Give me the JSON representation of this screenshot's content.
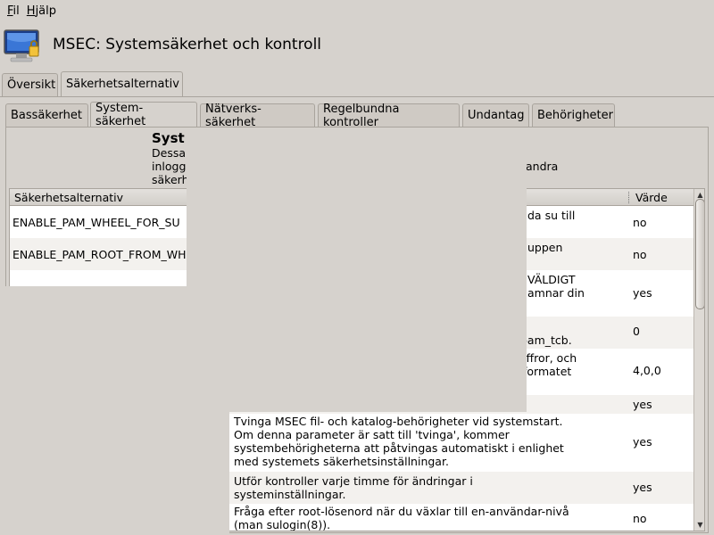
{
  "menubar": {
    "items": [
      {
        "label_first": "F",
        "label_rest": "il"
      },
      {
        "label_first": "H",
        "label_rest": "jälp"
      }
    ]
  },
  "app": {
    "title": "MSEC: Systemsäkerhet och kontroll",
    "icon": "monitor-lock-icon"
  },
  "top_tabs": [
    {
      "label": "Översikt",
      "active": false
    },
    {
      "label": "Säkerhetsalternativ",
      "active": true
    }
  ],
  "sub_tabs": [
    {
      "label": "Bassäkerhet",
      "active": false
    },
    {
      "label": "System-säkerhet",
      "active": true
    },
    {
      "label": "Nätverks-säkerhet",
      "active": false
    },
    {
      "label": "Regelbundna kontroller",
      "active": false
    },
    {
      "label": "Undantag",
      "active": false
    },
    {
      "label": "Behörigheter",
      "active": false
    }
  ],
  "section": {
    "title_visible": "Syst",
    "desc_line1": "Dessa",
    "desc_line2": "inlogg",
    "desc_line2_tail": "andra",
    "desc_line3": "säkerh"
  },
  "table": {
    "col_option": "Säkerhetsalternativ",
    "col_value": "Värde",
    "rows": [
      {
        "option": "ENABLE_PAM_WHEEL_FOR_SU",
        "desc": "da su till",
        "value": "no"
      },
      {
        "option": "ENABLE_PAM_ROOT_FROM_WH",
        "desc": "uppen",
        "value": "no"
      },
      {
        "option": "",
        "desc": "VÄLDIGT\namnar din",
        "value": "yes"
      },
      {
        "option": "",
        "desc": "pam_tcb.",
        "value": "0"
      },
      {
        "option": "",
        "desc": "iffror, och\n formatet",
        "value": "4,0,0"
      },
      {
        "option": "",
        "desc": "",
        "value": "yes"
      },
      {
        "option": "",
        "desc": "Tvinga MSEC fil- och katalog-behörigheter vid systemstart.\nOm denna parameter är satt till 'tvinga', kommer\nsystembehörigheterna att påtvingas automatiskt i enlighet\nmed systemets säkerhetsinställningar.",
        "value": "yes"
      },
      {
        "option": "",
        "desc": "Utför kontroller varje timme för ändringar i\nsysteminställningar.",
        "value": "yes"
      },
      {
        "option": "",
        "desc": "Fråga efter root-lösenord när du växlar till en-användar-nivå\n(man sulogin(8)).",
        "value": "no"
      }
    ]
  }
}
